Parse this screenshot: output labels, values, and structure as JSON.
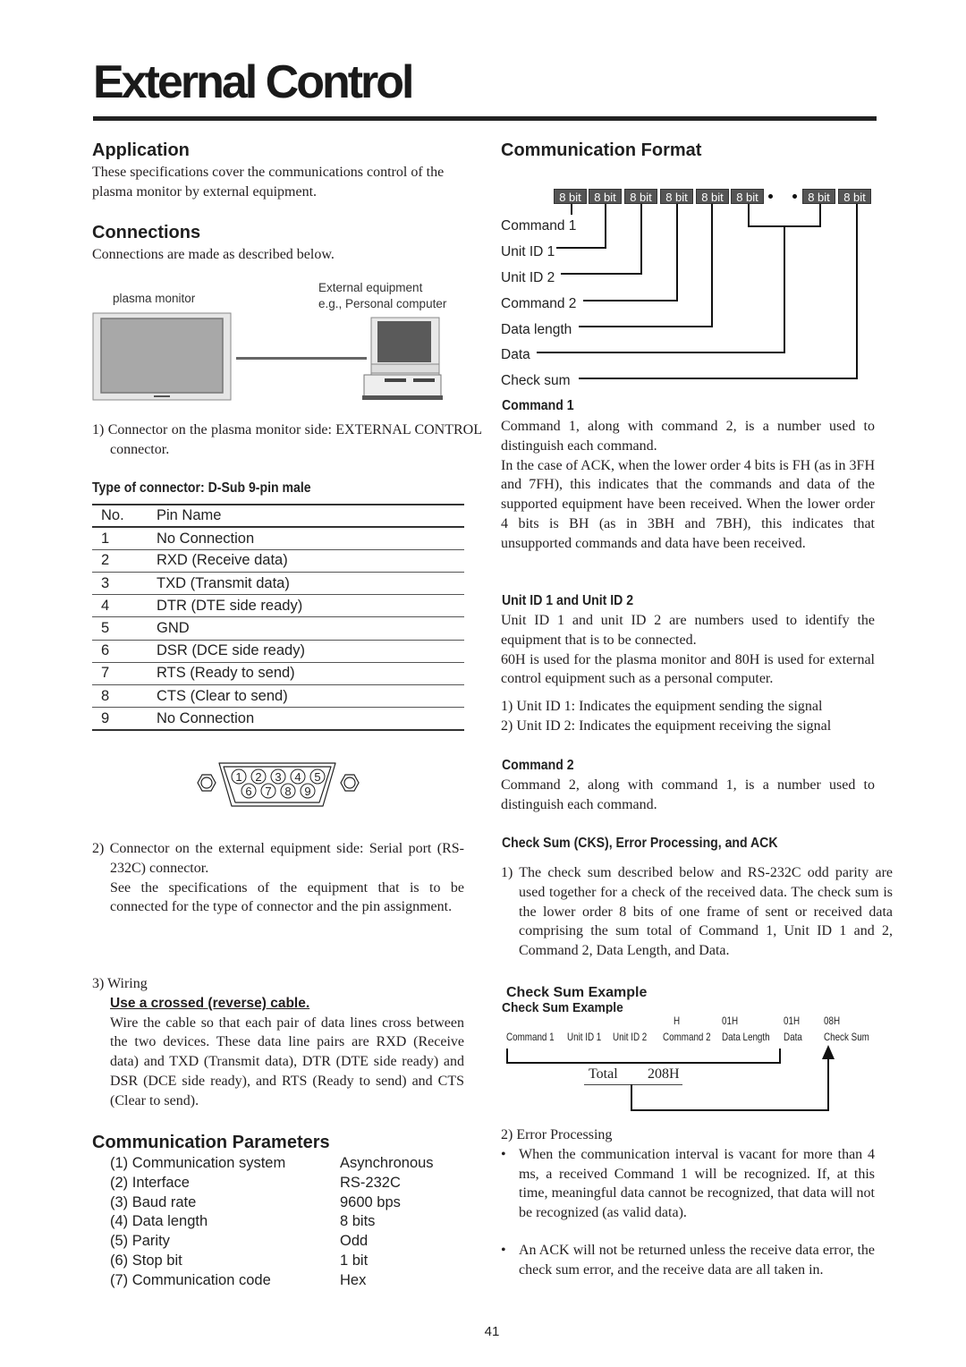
{
  "page": {
    "title": "External Control",
    "page_number": "41"
  },
  "application": {
    "heading": "Application",
    "text": "These specifications cover the communications control of the plasma monitor by external equipment."
  },
  "connections": {
    "heading": "Connections",
    "intro": "Connections are made as described below.",
    "diagram": {
      "plasma_label": "plasma monitor",
      "external_label_line1": "External equipment",
      "external_label_line2": "e.g., Personal computer"
    },
    "item1": "1) Connector on the plasma monitor side: EXTERNAL CONTROL connector.",
    "connector_type": "Type of connector: D-Sub 9-pin male",
    "pin_table": {
      "headers": [
        "No.",
        "Pin Name"
      ],
      "rows": [
        [
          "1",
          "No Connection"
        ],
        [
          "2",
          "RXD (Receive data)"
        ],
        [
          "3",
          "TXD (Transmit data)"
        ],
        [
          "4",
          "DTR (DTE side ready)"
        ],
        [
          "5",
          "GND"
        ],
        [
          "6",
          "DSR (DCE side ready)"
        ],
        [
          "7",
          "RTS (Ready to send)"
        ],
        [
          "8",
          "CTS (Clear to send)"
        ],
        [
          "9",
          "No Connection"
        ]
      ]
    },
    "connector_pins_top": [
      "1",
      "2",
      "3",
      "4",
      "5"
    ],
    "connector_pins_bottom": [
      "6",
      "7",
      "8",
      "9"
    ],
    "item2_line1": "2) Connector on the external equipment side: Serial port (RS-232C) connector.",
    "item2_line2": "See the specifications of the equipment that is to be connected for the type of connector and the pin assignment.",
    "item3_title": "3) Wiring",
    "item3_emphasis": "Use a crossed (reverse) cable.",
    "item3_text": "Wire the cable so that each pair of data lines cross between the two devices. These data line pairs are RXD (Receive data) and TXD (Transmit data), DTR (DTE side ready) and DSR (DCE side ready), and RTS (Ready to send) and CTS (Clear to send)."
  },
  "parameters": {
    "heading": "Communication Parameters",
    "items": [
      {
        "label": "(1) Communication system",
        "value": "Asynchronous"
      },
      {
        "label": "(2) Interface",
        "value": "RS-232C"
      },
      {
        "label": "(3) Baud rate",
        "value": "9600 bps"
      },
      {
        "label": "(4) Data length",
        "value": "8 bits"
      },
      {
        "label": "(5) Parity",
        "value": "Odd"
      },
      {
        "label": "(6) Stop bit",
        "value": "1 bit"
      },
      {
        "label": "(7) Communication code",
        "value": "Hex"
      }
    ]
  },
  "format": {
    "heading": "Communication Format",
    "bit_label": "8 bit",
    "fields": [
      "Command 1",
      "Unit ID 1",
      "Unit ID 2",
      "Command 2",
      "Data length",
      "Data",
      "Check sum"
    ]
  },
  "command1": {
    "heading": "Command 1",
    "p1": "Command 1, along with command 2, is a number used to distinguish each command.",
    "p2": "In the case of ACK, when the lower order 4 bits is FH (as in 3FH and 7FH), this indicates that the commands and data of the supported equipment have been received. When the lower order 4 bits is BH (as in 3BH and 7BH), this indicates that unsupported commands and data have been received."
  },
  "unit_id": {
    "heading": "Unit ID 1 and Unit ID 2",
    "p1": "Unit ID 1 and unit ID 2 are numbers used to identify the equipment that is to be connected.",
    "p2": "60H is used for the plasma monitor and 80H is used for external control equipment such as a personal computer.",
    "item1": "1) Unit ID 1: Indicates the equipment sending the signal",
    "item2": "2) Unit ID 2: Indicates the equipment receiving the signal"
  },
  "command2": {
    "heading": "Command 2",
    "p1": "Command 2, along with command 1, is a number used to distinguish each command."
  },
  "checksum": {
    "heading": "Check Sum (CKS), Error Processing, and ACK",
    "item1": "1) The check sum described below and RS-232C odd parity are used together for a check of the received data. The check sum is the lower order 8 bits of one frame of sent or received data comprising the sum total of Command 1, Unit ID 1 and 2, Command 2, Data Length, and Data.",
    "example_heading": "Check Sum Example",
    "example": {
      "values": {
        "command2": "H",
        "data_length": "01H",
        "data": "01H",
        "check_sum": "08H"
      },
      "labels": [
        "Command 1",
        "Unit ID 1",
        "Unit ID 2",
        "Command 2",
        "Data Length",
        "Data",
        "Check Sum"
      ],
      "total_label": "Total",
      "total_value": "208H"
    },
    "item2_title": "2) Error Processing",
    "bullet1": "When the communication interval is vacant for more than 4 ms,  a received Command 1 will be recognized. If, at this time, meaningful data cannot be recognized, that data will not be recognized (as valid data).",
    "bullet2": "An ACK will not be returned unless the receive data error, the check sum error, and the receive data are all taken in."
  }
}
